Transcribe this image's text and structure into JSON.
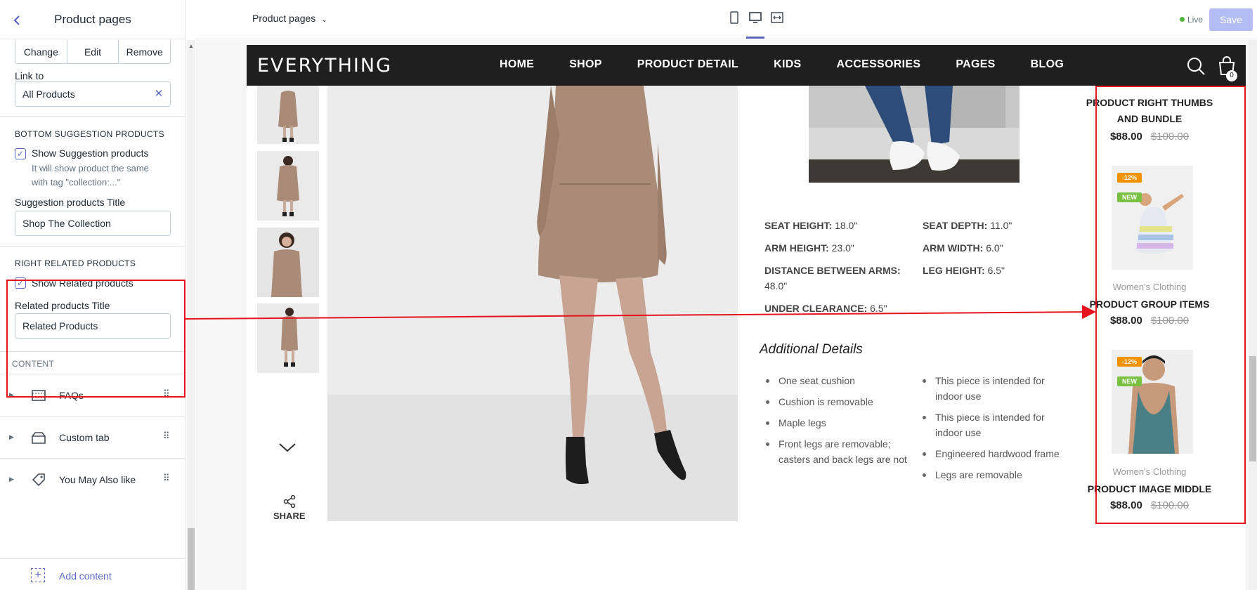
{
  "sidebar": {
    "title": "Product pages",
    "segment": [
      "Change",
      "Edit",
      "Remove"
    ],
    "link_to_label": "Link to",
    "link_to_value": "All Products",
    "bottom_suggestion": {
      "heading": "BOTTOM SUGGESTION PRODUCTS",
      "checkbox_label": "Show Suggestion products",
      "help": "It will show product the same with tag \"collection:...\"",
      "title_label": "Suggestion products Title",
      "title_value": "Shop The Collection"
    },
    "right_related": {
      "heading": "RIGHT RELATED PRODUCTS",
      "checkbox_label": "Show Related products",
      "title_label": "Related products Title",
      "title_value": "Related Products"
    },
    "content_heading": "CONTENT",
    "blocks": [
      {
        "label": "FAQs",
        "icon": "faq-icon"
      },
      {
        "label": "Custom tab",
        "icon": "custom-tab-icon"
      },
      {
        "label": "You May Also like",
        "icon": "tag-icon"
      }
    ],
    "add_content": "Add content"
  },
  "topbar": {
    "page_select": "Product pages",
    "status": "Live",
    "save_label": "Save",
    "accent": "#5c6ac4"
  },
  "store": {
    "logo": "EVERYTHING",
    "menu": [
      "HOME",
      "SHOP",
      "PRODUCT DETAIL",
      "KIDS",
      "ACCESSORIES",
      "PAGES",
      "BLOG"
    ],
    "cart_count": "0",
    "share_label": "SHARE",
    "specs": [
      {
        "label": "SEAT HEIGHT:",
        "value": "18.0\""
      },
      {
        "label": "SEAT DEPTH:",
        "value": "11.0\""
      },
      {
        "label": "ARM HEIGHT:",
        "value": "23.0\""
      },
      {
        "label": "ARM WIDTH:",
        "value": "6.0\""
      },
      {
        "label": "DISTANCE BETWEEN ARMS:",
        "value": "48.0\""
      },
      {
        "label": "LEG HEIGHT:",
        "value": "6.5\""
      },
      {
        "label": "UNDER CLEARANCE:",
        "value": "6.5\""
      }
    ],
    "additional_title": "Additional Details",
    "details_left": [
      "One seat cushion",
      "Cushion is removable",
      "Maple legs",
      "Front legs are removable; casters and back legs are not"
    ],
    "details_right": [
      "This piece is intended for indoor use",
      "This piece is intended for indoor use",
      "Engineered hardwood frame",
      "Legs are removable"
    ],
    "related": [
      {
        "title": "PRODUCT RIGHT THUMBS AND BUNDLE",
        "price": "$88.00",
        "old_price": "$100.00"
      },
      {
        "category": "Women's Clothing",
        "title": "PRODUCT GROUP ITEMS",
        "price": "$88.00",
        "old_price": "$100.00",
        "sale_badge": "-12%",
        "new_badge": "NEW"
      },
      {
        "category": "Women's Clothing",
        "title": "PRODUCT IMAGE MIDDLE",
        "price": "$88.00",
        "old_price": "$100.00",
        "sale_badge": "-12%",
        "new_badge": "NEW"
      }
    ],
    "annotation_color": "#e5131d"
  }
}
